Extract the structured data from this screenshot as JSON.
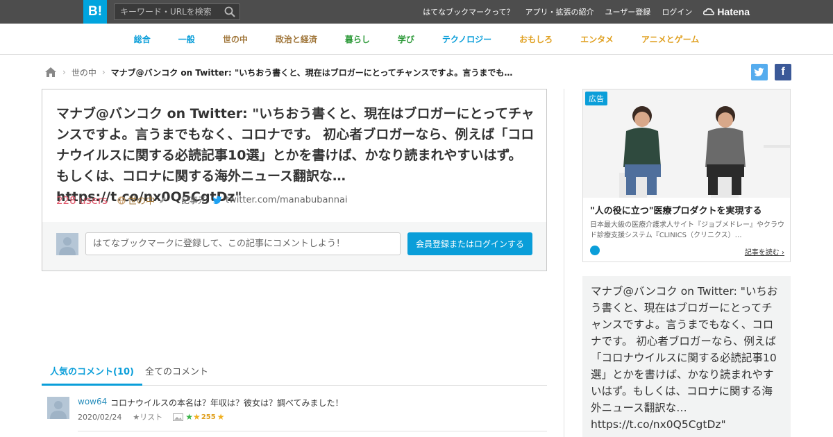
{
  "topbar": {
    "logo": "B!",
    "search_placeholder": "キーワード・URLを検索",
    "nav": [
      "はてなブックマークって？",
      "アプリ・拡張の紹介",
      "ユーザー登録",
      "ログイン"
    ],
    "brand": "Hatena"
  },
  "categories": [
    {
      "label": "総合",
      "color": "#0a9ed9"
    },
    {
      "label": "一般",
      "color": "#0a9ed9"
    },
    {
      "label": "世の中",
      "color": "#a0763a"
    },
    {
      "label": "政治と経済",
      "color": "#a0763a"
    },
    {
      "label": "暮らし",
      "color": "#2e9a3a"
    },
    {
      "label": "学び",
      "color": "#2e9a3a"
    },
    {
      "label": "テクノロジー",
      "color": "#0a9ed9"
    },
    {
      "label": "おもしろ",
      "color": "#e0a020"
    },
    {
      "label": "エンタメ",
      "color": "#e0a020"
    },
    {
      "label": "アニメとゲーム",
      "color": "#e0a020"
    }
  ],
  "breadcrumb": {
    "home": "home",
    "category": "世の中",
    "current": "マナブ@バンコク on Twitter: \"いちおう書くと、現在はブロガーにとってチャンスですよ。言うまでもなく…"
  },
  "entry": {
    "title": "マナブ@バンコク on Twitter: \"いちおう書くと、現在はブロガーにとってチャンスですよ。言うまでもなく、コロナです。 初心者ブロガーなら、例えば「コロナウイルスに関する必読記事10選」とかを書けば、かなり読まれやすいはず。 もしくは、コロナに関する海外ニュース翻訳な… https://t.co/nx0Q5CgtDz\"",
    "users": "228 users",
    "tag": "世の中",
    "source_label": "記事元:",
    "source": "twitter.com/manabubannai"
  },
  "comment_form": {
    "placeholder": "はてなブックマークに登録して、この記事にコメントしよう！",
    "button": "会員登録またはログインする"
  },
  "tabs": [
    "人気のコメント(10)",
    "全てのコメント"
  ],
  "comments": [
    {
      "user": "wow64",
      "text": "コロナウイルスの本名は？年収は？彼女は？調べてみました！",
      "date": "2020/02/24",
      "list": "★リスト",
      "stars": "255"
    }
  ],
  "ad": {
    "badge": "広告",
    "title": "\"人の役に立つ\"医療プロダクトを実現する",
    "desc": "日本最大級の医療介護求人サイト『ジョブメドレー』やクラウド診療支援システム『CLINICS（クリニクス）…",
    "link": "記事を読む"
  },
  "description": "マナブ@バンコク on Twitter: \"いちおう書くと、現在はブロガーにとってチャンスですよ。言うまでもなく、コロナです。 初心者ブロガーなら、例えば「コロナウイルスに関する必読記事10選」とかを書けば、かなり読まれやすいはず。もしくは、コロナに関する海外ニュース翻訳な… https://t.co/nx0Q5CgtDz\""
}
